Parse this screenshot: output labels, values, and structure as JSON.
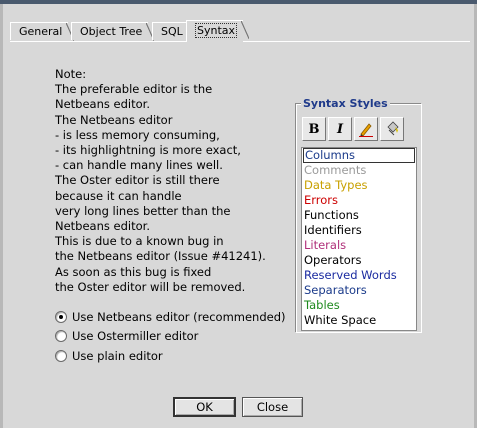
{
  "tabs": [
    "General",
    "Object Tree",
    "SQL",
    "Syntax"
  ],
  "active_tab": "Syntax",
  "note_lines": [
    "Note:",
    "The preferable editor is the",
    "Netbeans editor.",
    "The Netbeans editor",
    "- is less memory consuming,",
    "- its highlightning is more exact,",
    "- can handle many lines well.",
    "The Oster editor is still there",
    "because it can handle",
    "very long lines better than the",
    "Netbeans editor.",
    "This is due to a known bug in",
    "the Netbeans editor (Issue #41241).",
    "As soon as this bug is fixed",
    "the Oster editor will be removed."
  ],
  "editor_options": [
    {
      "label": "Use Netbeans editor (recommended)",
      "checked": true
    },
    {
      "label": "Use Ostermiller editor",
      "checked": false
    },
    {
      "label": "Use plain editor",
      "checked": false
    }
  ],
  "syntax_styles": {
    "title": "Syntax Styles",
    "toolbar": {
      "bold": "B",
      "italic": "I"
    },
    "items": [
      {
        "label": "Columns",
        "color": "#1a3a8a",
        "selected": true
      },
      {
        "label": "Comments",
        "color": "#9a9a9a"
      },
      {
        "label": "Data Types",
        "color": "#c8a000"
      },
      {
        "label": "Errors",
        "color": "#cc0000"
      },
      {
        "label": "Functions",
        "color": "#000000"
      },
      {
        "label": "Identifiers",
        "color": "#000000"
      },
      {
        "label": "Literals",
        "color": "#b0307a"
      },
      {
        "label": "Operators",
        "color": "#000000"
      },
      {
        "label": "Reserved Words",
        "color": "#1a2aa0"
      },
      {
        "label": "Separators",
        "color": "#1a3a8a"
      },
      {
        "label": "Tables",
        "color": "#1e8a1e"
      },
      {
        "label": "White Space",
        "color": "#000000"
      }
    ]
  },
  "buttons": {
    "ok": "OK",
    "close": "Close"
  }
}
